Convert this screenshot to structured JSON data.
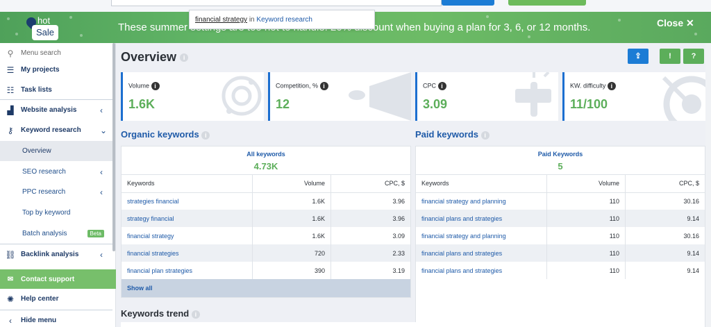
{
  "search_suggestion": {
    "query": "financial strategy",
    "in_word": "in",
    "scope": "Keyword research"
  },
  "banner": {
    "logo_top": "hot",
    "logo_bottom": "Sale",
    "message": "These summer settings are too hot to handle: 20% discount when buying a plan for 3, 6, or 12 months.",
    "close_label": "Close ✕"
  },
  "sidebar": {
    "search_label": "Menu search",
    "items": [
      {
        "label": "My projects"
      },
      {
        "label": "Task lists"
      },
      {
        "label": "Website analysis",
        "chev": "‹"
      },
      {
        "label": "Keyword research",
        "chev": "⌄"
      },
      {
        "label": "Overview"
      },
      {
        "label": "SEO research",
        "chev": "‹"
      },
      {
        "label": "PPC research",
        "chev": "‹"
      },
      {
        "label": "Top by keyword"
      },
      {
        "label": "Batch analysis",
        "badge": "Beta"
      },
      {
        "label": "Backlink analysis",
        "chev": "‹"
      }
    ],
    "contact_label": "Contact support",
    "help_label": "Help center",
    "hide_label": "Hide menu"
  },
  "main": {
    "title": "Overview",
    "cards": [
      {
        "label": "Volume",
        "value": "1.6K"
      },
      {
        "label": "Competition, %",
        "value": "12"
      },
      {
        "label": "CPC",
        "value": "3.09"
      },
      {
        "label": "KW. difficulty",
        "value": "11/100"
      }
    ],
    "organic": {
      "section_title": "Organic keywords",
      "panel_title": "All keywords",
      "panel_value": "4.73K",
      "headers": [
        "Keywords",
        "Volume",
        "CPC, $"
      ],
      "rows": [
        [
          "strategies financial",
          "1.6K",
          "3.96"
        ],
        [
          "strategy financial",
          "1.6K",
          "3.96"
        ],
        [
          "financial strategy",
          "1.6K",
          "3.09"
        ],
        [
          "financial strategies",
          "720",
          "2.33"
        ],
        [
          "financial plan strategies",
          "390",
          "3.19"
        ]
      ],
      "show_all": "Show all"
    },
    "paid": {
      "section_title": "Paid keywords",
      "panel_title": "Paid Keywords",
      "panel_value": "5",
      "headers": [
        "Keywords",
        "Volume",
        "CPC, $"
      ],
      "rows": [
        [
          "financial strategy and planning",
          "110",
          "30.16"
        ],
        [
          "financial plans and strategies",
          "110",
          "9.14"
        ],
        [
          "financial strategy and planning",
          "110",
          "30.16"
        ],
        [
          "financial plans and strategies",
          "110",
          "9.14"
        ],
        [
          "financial plans and strategies",
          "110",
          "9.14"
        ]
      ]
    },
    "trend_title": "Keywords trend"
  },
  "colors": {
    "accent_blue": "#1c7cd5",
    "accent_green": "#6dbb66",
    "value_green": "#5cae5a",
    "link_blue": "#1e5aa8"
  }
}
